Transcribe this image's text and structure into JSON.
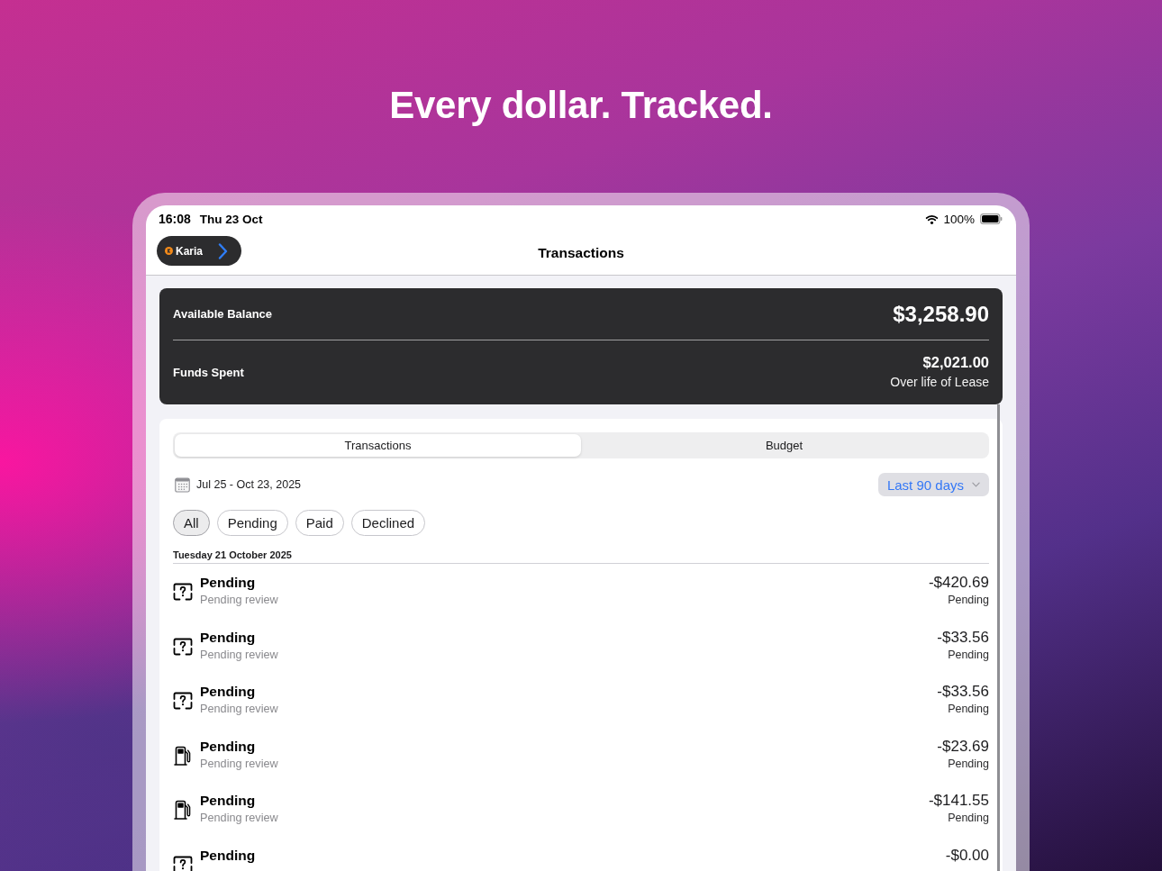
{
  "headline": "Every dollar. Tracked.",
  "status_bar": {
    "time": "16:08",
    "date": "Thu 23 Oct",
    "battery_text": "100%"
  },
  "nav_bar": {
    "account_button": "Karia",
    "title": "Transactions"
  },
  "balance_card": {
    "available_label": "Available Balance",
    "available_amount": "$3,258.90",
    "spent_label": "Funds Spent",
    "spent_amount": "$2,021.00",
    "spent_note": "Over life of Lease"
  },
  "segments": [
    {
      "label": "Transactions",
      "selected": true
    },
    {
      "label": "Budget",
      "selected": false
    }
  ],
  "date_range": {
    "text": "Jul 25 - Oct 23, 2025",
    "period_button": "Last 90 days"
  },
  "filters": [
    {
      "label": "All",
      "selected": true
    },
    {
      "label": "Pending",
      "selected": false
    },
    {
      "label": "Paid",
      "selected": false
    },
    {
      "label": "Declined",
      "selected": false
    }
  ],
  "sections": [
    {
      "header": "Tuesday 21 October 2025",
      "transactions": [
        {
          "kind": "uncategorized",
          "title": "Pending",
          "subtitle": "Pending review",
          "amount": "-$420.69",
          "status": "Pending"
        },
        {
          "kind": "uncategorized",
          "title": "Pending",
          "subtitle": "Pending review",
          "amount": "-$33.56",
          "status": "Pending"
        },
        {
          "kind": "uncategorized",
          "title": "Pending",
          "subtitle": "Pending review",
          "amount": "-$33.56",
          "status": "Pending"
        },
        {
          "kind": "fuel",
          "title": "Pending",
          "subtitle": "Pending review",
          "amount": "-$23.69",
          "status": "Pending"
        },
        {
          "kind": "fuel",
          "title": "Pending",
          "subtitle": "Pending review",
          "amount": "-$141.55",
          "status": "Pending"
        },
        {
          "kind": "uncategorized",
          "title": "Pending",
          "amount": "-$0.00"
        }
      ]
    }
  ]
}
